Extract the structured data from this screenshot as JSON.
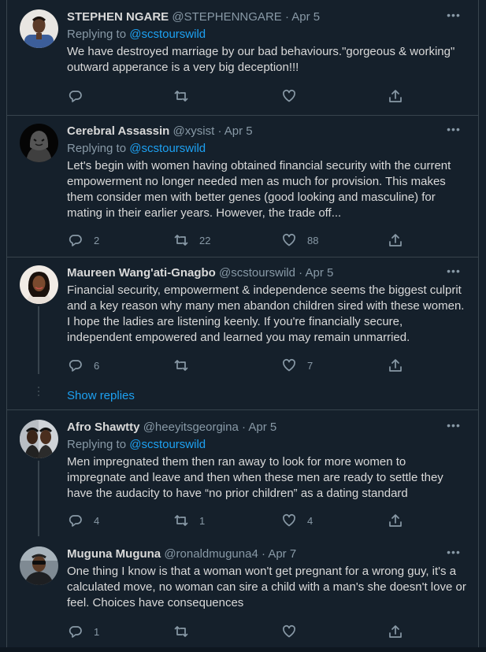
{
  "colors": {
    "background": "#15202b",
    "border": "#38444d",
    "accent": "#1da1f2",
    "muted": "#8899a6",
    "text": "#d9d9d9"
  },
  "tweets": [
    {
      "name": "STEPHEN NGARE",
      "handle": "@STEPHENNGARE",
      "date": "Apr 5",
      "reply_prefix": "Replying to ",
      "reply_to": "@scstourswild",
      "text": "We have destroyed marriage by our bad behaviours.\"gorgeous & working\"\noutward apperance is a very big deception!!!",
      "replies": "",
      "retweets": "",
      "likes": ""
    },
    {
      "name": "Cerebral Assassin",
      "handle": "@xysist",
      "date": "Apr 5",
      "reply_prefix": "Replying to ",
      "reply_to": "@scstourswild",
      "text": "Let's begin with women having obtained financial security with the current\nempowerment no longer needed men as much for provision. This makes\nthem consider men with better genes (good looking and masculine) for\nmating in their earlier years. However, the trade off...",
      "replies": "2",
      "retweets": "22",
      "likes": "88"
    },
    {
      "name": "Maureen Wang'ati-Gnagbo",
      "handle": "@scstourswild",
      "date": "Apr 5",
      "text": "Financial security, empowerment & independence seems the biggest culprit\nand a key reason why many men abandon children sired with these women.\nI hope the ladies are listening keenly. If you're financially secure,\nindependent empowered and learned you may remain unmarried.",
      "replies": "6",
      "retweets": "",
      "likes": "7",
      "show_replies": "Show replies"
    },
    {
      "name": "Afro Shawtty",
      "handle": "@heeyitsgeorgina",
      "date": "Apr 5",
      "reply_prefix": "Replying to ",
      "reply_to": "@scstourswild",
      "text": "Men impregnated them then ran away to look for more women to\nimpregnate and leave and then when these men are ready to settle they\nhave the audacity to have “no prior children” as a dating standard",
      "replies": "4",
      "retweets": "1",
      "likes": "4"
    },
    {
      "name": "Muguna Muguna",
      "handle": "@ronaldmuguna4",
      "date": "Apr 7",
      "text": "One thing I know is that a woman won't get pregnant for a wrong guy, it's a\ncalculated move, no woman can sire a child with a man's she doesn't love or\nfeel. Choices have consequences",
      "replies": "1",
      "retweets": "",
      "likes": ""
    }
  ],
  "separator": "·",
  "more_glyph": "•••"
}
